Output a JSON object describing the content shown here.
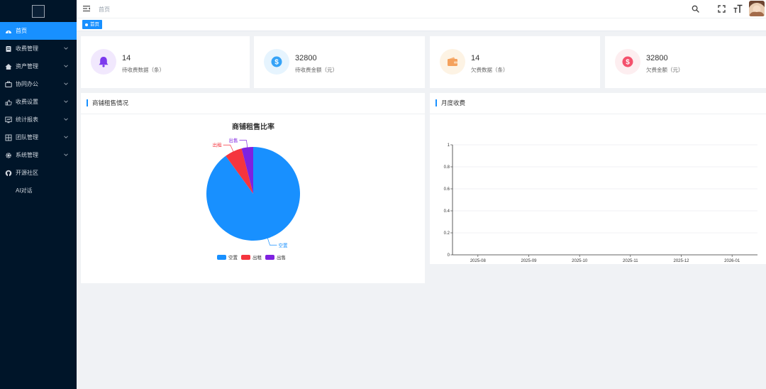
{
  "sidebar": {
    "items": [
      {
        "label": "首页",
        "icon": "dashboard-icon",
        "active": true,
        "expandable": false
      },
      {
        "label": "收费管理",
        "icon": "receipt-icon",
        "active": false,
        "expandable": true
      },
      {
        "label": "资产管理",
        "icon": "home-icon",
        "active": false,
        "expandable": true
      },
      {
        "label": "协同办公",
        "icon": "office-icon",
        "active": false,
        "expandable": true
      },
      {
        "label": "收费设置",
        "icon": "settings-hand-icon",
        "active": false,
        "expandable": true
      },
      {
        "label": "统计报表",
        "icon": "chart-icon",
        "active": false,
        "expandable": true
      },
      {
        "label": "团队管理",
        "icon": "team-icon",
        "active": false,
        "expandable": true
      },
      {
        "label": "系统管理",
        "icon": "gear-icon",
        "active": false,
        "expandable": true
      },
      {
        "label": "开源社区",
        "icon": "github-icon",
        "active": false,
        "expandable": false
      },
      {
        "label": "AI对话",
        "icon": "",
        "active": false,
        "expandable": false
      }
    ]
  },
  "header": {
    "breadcrumb": "首页",
    "icons": [
      "hamburger-icon",
      "search-icon",
      "fullscreen-icon",
      "font-size-icon"
    ]
  },
  "tags": {
    "active_label": "首页"
  },
  "stats": [
    {
      "value": "14",
      "label": "待收费数据（条）",
      "icon": "bell-icon",
      "color": "#7c3aed",
      "bg": "#f1e8fd"
    },
    {
      "value": "32800",
      "label": "待收费金额（元）",
      "icon": "dollar-circle-icon",
      "color": "#36a3f7",
      "bg": "#e6f4fe"
    },
    {
      "value": "14",
      "label": "欠费数据（条）",
      "icon": "wallet-icon",
      "color": "#f4a15d",
      "bg": "#fdf3e4"
    },
    {
      "value": "32800",
      "label": "欠费金额（元）",
      "icon": "dollar-circle-icon",
      "color": "#f4516c",
      "bg": "#fdeef0"
    }
  ],
  "panels": {
    "left_title": "商铺租售情况",
    "right_title": "月度收费"
  },
  "colors": {
    "accent": "#1890ff",
    "sidebar_bg": "#001529",
    "page_bg": "#f0f2f5"
  },
  "chart_data": [
    {
      "type": "pie",
      "title": "商铺租售比率",
      "categories": [
        "空置",
        "出租",
        "出售"
      ],
      "values": [
        90,
        6,
        4
      ],
      "colors": [
        "#1890ff",
        "#f5353e",
        "#7e22e0"
      ],
      "legend": {
        "placement": "bottom-center",
        "entries": [
          "空置",
          "出租",
          "出售"
        ]
      }
    },
    {
      "type": "line",
      "title": "",
      "x": [
        "2025-08",
        "2025-09",
        "2025-10",
        "2025-11",
        "2025-12",
        "2026-01"
      ],
      "series": [],
      "ylim": [
        0,
        1
      ],
      "yticks": [
        "0",
        "0.2",
        "0.4",
        "0.6",
        "0.8",
        "1"
      ],
      "grid": true
    }
  ]
}
